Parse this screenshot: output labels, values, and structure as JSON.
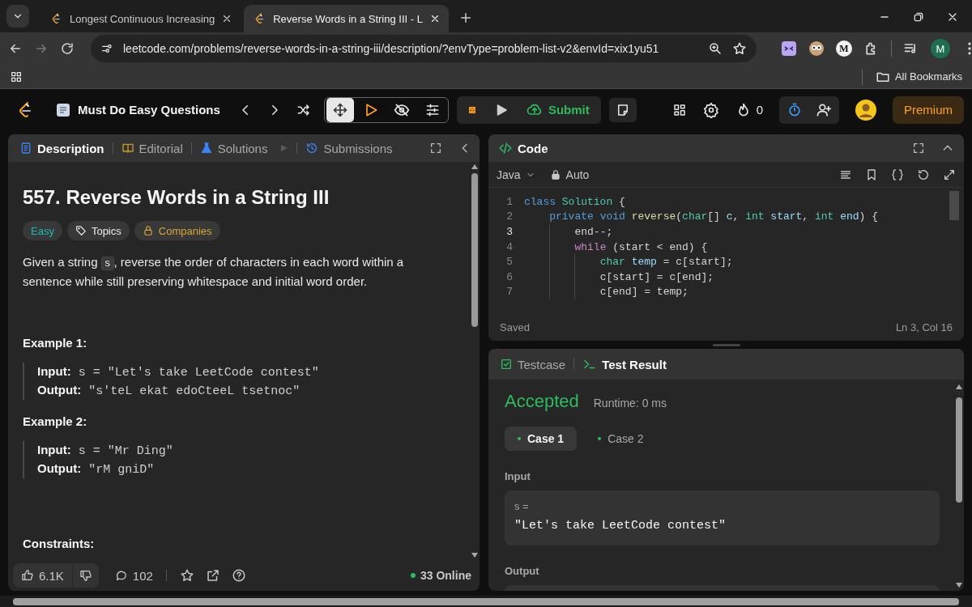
{
  "browser": {
    "tabs": [
      {
        "title": "Longest Continuous Increasing",
        "selected": false
      },
      {
        "title": "Reverse Words in a String III - L",
        "selected": true
      }
    ],
    "url": "leetcode.com/problems/reverse-words-in-a-string-iii/description/?envType=problem-list-v2&envId=xix1yu51",
    "extension_badge": "M",
    "profile_initial": "M",
    "bookmarks_label": "All Bookmarks"
  },
  "header": {
    "list_title": "Must Do Easy Questions",
    "submit": "Submit",
    "streak": "0",
    "premium": "Premium"
  },
  "description": {
    "tabs": [
      {
        "label": "Description",
        "kind": "doc",
        "selected": true
      },
      {
        "label": "Editorial",
        "kind": "book",
        "selected": false
      },
      {
        "label": "Solutions",
        "kind": "flask",
        "selected": false
      },
      {
        "label": "Submissions",
        "kind": "history",
        "selected": false
      }
    ],
    "title": "557. Reverse Words in a String III",
    "tags": [
      {
        "label": "Easy",
        "kind": "difficulty"
      },
      {
        "label": "Topics",
        "kind": "topics"
      },
      {
        "label": "Companies",
        "kind": "companies"
      }
    ],
    "statement": {
      "before": "Given a string ",
      "code": "s",
      "after": ", reverse the order of characters in each word within a sentence while still preserving whitespace and initial word order."
    },
    "examples": [
      {
        "title": "Example 1:",
        "input_label": "Input:",
        "input": "s = \"Let's take LeetCode contest\"",
        "output_label": "Output:",
        "output": "\"s'teL ekat edoCteeL tsetnoc\""
      },
      {
        "title": "Example 2:",
        "input_label": "Input:",
        "input": "s = \"Mr Ding\"",
        "output_label": "Output:",
        "output": "\"rM gniD\""
      }
    ],
    "constraints_title": "Constraints:",
    "likes": "6.1K",
    "comments": "102",
    "online": "33 Online"
  },
  "code": {
    "title": "Code",
    "language": "Java",
    "mode": "Auto",
    "lines": [
      {
        "number": "1",
        "current": false,
        "tokens": [
          {
            "text": "class",
            "kind": "keyword"
          },
          {
            "text": " Solution",
            "kind": "type"
          },
          {
            "text": " {",
            "kind": "plain"
          }
        ]
      },
      {
        "number": "2",
        "current": false,
        "tokens": [
          {
            "text": "    private",
            "kind": "keyword"
          },
          {
            "text": " void",
            "kind": "keyword"
          },
          {
            "text": " reverse",
            "kind": "function"
          },
          {
            "text": "(",
            "kind": "plain"
          },
          {
            "text": "char",
            "kind": "type"
          },
          {
            "text": "[] ",
            "kind": "plain"
          },
          {
            "text": "c",
            "kind": "variable"
          },
          {
            "text": ", ",
            "kind": "plain"
          },
          {
            "text": "int",
            "kind": "type"
          },
          {
            "text": " start",
            "kind": "variable"
          },
          {
            "text": ", ",
            "kind": "plain"
          },
          {
            "text": "int",
            "kind": "type"
          },
          {
            "text": " end",
            "kind": "variable"
          },
          {
            "text": ") {",
            "kind": "plain"
          }
        ]
      },
      {
        "number": "3",
        "current": true,
        "tokens": [
          {
            "text": "        end--;",
            "kind": "plain"
          }
        ]
      },
      {
        "number": "4",
        "current": false,
        "tokens": [
          {
            "text": "        while",
            "kind": "control"
          },
          {
            "text": " (start < end) {",
            "kind": "plain"
          }
        ]
      },
      {
        "number": "5",
        "current": false,
        "tokens": [
          {
            "text": "            char",
            "kind": "type"
          },
          {
            "text": " temp",
            "kind": "variable"
          },
          {
            "text": " = c[start];",
            "kind": "plain"
          }
        ]
      },
      {
        "number": "6",
        "current": false,
        "tokens": [
          {
            "text": "            c[start] = c[end];",
            "kind": "plain"
          }
        ]
      },
      {
        "number": "7",
        "current": false,
        "tokens": [
          {
            "text": "            c[end] = temp;",
            "kind": "plain"
          }
        ]
      }
    ],
    "status": "Saved",
    "cursor": "Ln 3, Col 16"
  },
  "result": {
    "tabs": [
      {
        "label": "Testcase",
        "kind": "checkbox",
        "selected": false
      },
      {
        "label": "Test Result",
        "kind": "terminal",
        "selected": true
      }
    ],
    "verdict": "Accepted",
    "runtime": "Runtime: 0 ms",
    "cases": [
      {
        "label": "Case 1",
        "passed": true,
        "selected": true
      },
      {
        "label": "Case 2",
        "passed": true,
        "selected": false
      }
    ],
    "input_label": "Input",
    "params": [
      {
        "name": "s =",
        "value": "\"Let's take LeetCode contest\""
      }
    ],
    "output_label": "Output"
  }
}
